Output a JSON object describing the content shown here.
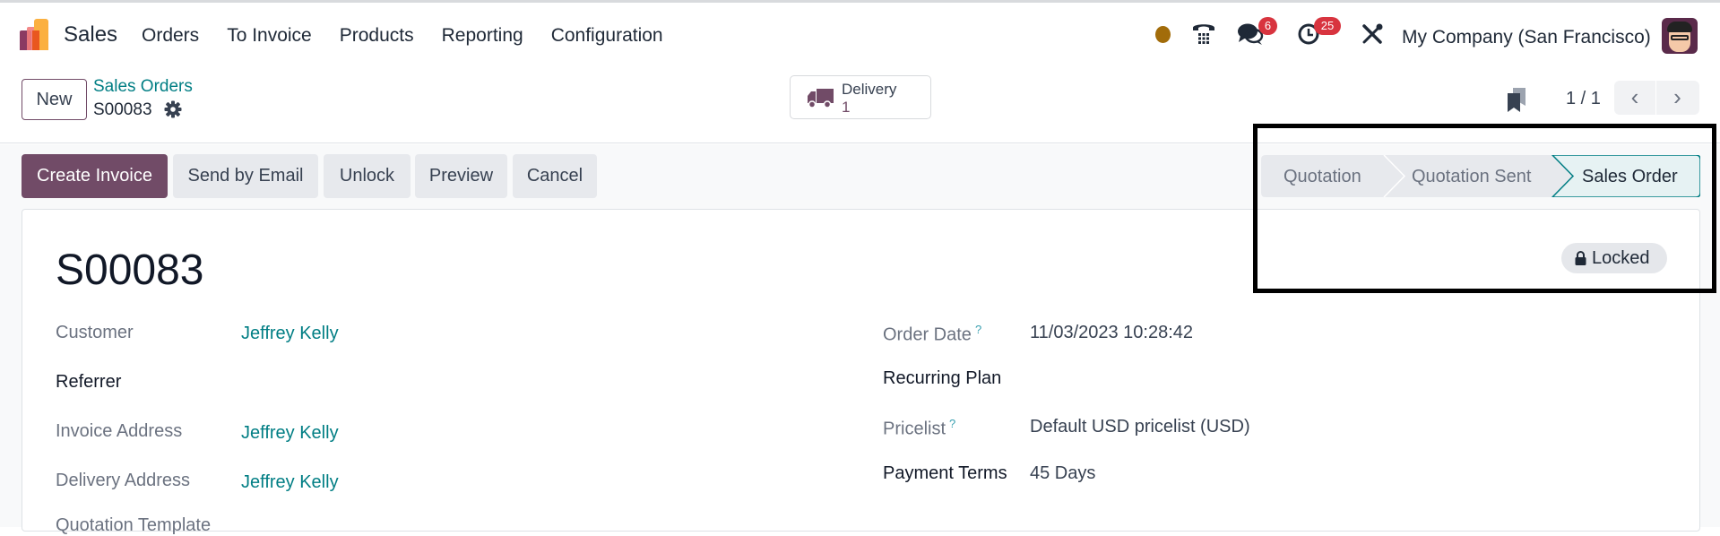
{
  "navbar": {
    "app_name": "Sales",
    "menu": [
      "Orders",
      "To Invoice",
      "Products",
      "Reporting",
      "Configuration"
    ],
    "messages_count": "6",
    "activities_count": "25",
    "company": "My Company (San Francisco)",
    "icons": {
      "status": "status-dot",
      "phone": "☎",
      "chat": "💬",
      "clock": "◷",
      "tools": "✕"
    }
  },
  "control_panel": {
    "new_label": "New",
    "breadcrumb_parent": "Sales Orders",
    "breadcrumb_current": "S00083",
    "gear_glyph": "⚙",
    "smart_button": {
      "label": "Delivery",
      "value": "1"
    },
    "pager": {
      "value": "1 / 1",
      "prev": "‹",
      "next": "›"
    }
  },
  "statusbar": {
    "buttons": [
      "Create Invoice",
      "Send by Email",
      "Unlock",
      "Preview",
      "Cancel"
    ],
    "stages": [
      "Quotation",
      "Quotation Sent",
      "Sales Order"
    ],
    "current_stage": "Sales Order"
  },
  "sheet": {
    "title": "S00083",
    "locked_label": "Locked",
    "left_fields": [
      {
        "label": "Customer",
        "value": "Jeffrey Kelly"
      },
      {
        "label": "Referrer",
        "value": ""
      },
      {
        "label": "Invoice Address",
        "value": "Jeffrey Kelly"
      },
      {
        "label": "Delivery Address",
        "value": "Jeffrey Kelly"
      },
      {
        "label": "Quotation Template",
        "value": ""
      }
    ],
    "right_fields": [
      {
        "label": "Order Date",
        "value": "11/03/2023 10:28:42",
        "help": "?"
      },
      {
        "label": "Recurring Plan",
        "value": ""
      },
      {
        "label": "Pricelist",
        "value": "Default USD pricelist (USD)",
        "help": "?"
      },
      {
        "label": "Payment Terms",
        "value": "45 Days"
      }
    ]
  },
  "colors": {
    "brand": "#714b67",
    "link": "#017e84",
    "badge": "#d8343f"
  }
}
